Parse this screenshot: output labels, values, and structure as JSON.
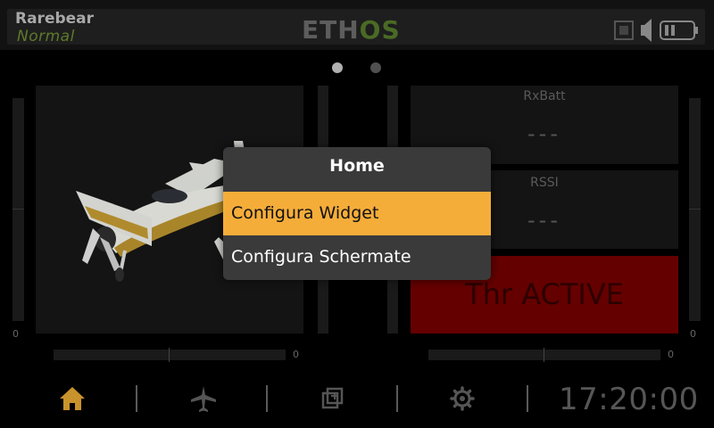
{
  "header": {
    "model_name": "Rarebear",
    "flight_mode": "Normal",
    "logo_left": "ETH",
    "logo_right": "OS",
    "icons": [
      "model-image-icon",
      "speaker-icon",
      "battery-icon"
    ]
  },
  "pages": {
    "count": 2,
    "active": 1
  },
  "left_panel": {
    "image": "airplane-image",
    "trim_left_value": "0",
    "trim_bottom_value": "0"
  },
  "right_panel": {
    "widgets": [
      {
        "title": "RxBatt",
        "value": "---"
      },
      {
        "title": "RSSI",
        "value": "---"
      }
    ],
    "thr_label": "Thr ACTIVE",
    "trim_right_value": "0",
    "trim_bottom_value": "0"
  },
  "modal": {
    "title": "Home",
    "items": [
      {
        "label": "Configura Widget",
        "selected": true
      },
      {
        "label": "Configura Schermate",
        "selected": false
      }
    ]
  },
  "nav": {
    "items": [
      "home-icon",
      "airplane-icon",
      "system-icon",
      "settings-icon"
    ],
    "clock": "17:20:00"
  },
  "colors": {
    "accent": "#f5ad3a",
    "thr_active_bg": "#650000",
    "flight_mode": "#5e7a2a",
    "home_icon": "#c8922c"
  }
}
